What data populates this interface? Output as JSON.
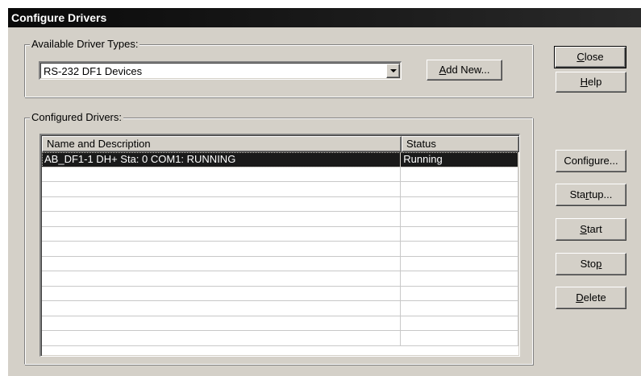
{
  "window": {
    "title": "Configure Drivers"
  },
  "available": {
    "group_label": "Available Driver Types:",
    "selected_value": "RS-232 DF1 Devices",
    "add_new": {
      "mnemonic": "A",
      "rest": "dd New..."
    }
  },
  "configured": {
    "group_label": "Configured Drivers:",
    "columns": [
      "Name and Description",
      "Status"
    ],
    "rows": [
      {
        "name": "AB_DF1-1  DH+ Sta: 0 COM1: RUNNING",
        "status": "Running",
        "selected": true
      }
    ],
    "empty_row_count": 12
  },
  "buttons": {
    "close": {
      "mnemonic": "C",
      "rest": "lose"
    },
    "help": {
      "mnemonic": "H",
      "rest": "elp"
    },
    "configure": {
      "before": "Confi",
      "mnemonic": "g",
      "after": "ure..."
    },
    "startup": {
      "before": "Sta",
      "mnemonic": "r",
      "after": "tup..."
    },
    "start": {
      "mnemonic": "S",
      "rest": "tart"
    },
    "stop": {
      "before": "Sto",
      "mnemonic": "p",
      "after": ""
    },
    "delete": {
      "mnemonic": "D",
      "rest": "elete"
    }
  },
  "colors": {
    "face": "#d4d0c8",
    "selection": "#1a1a1a",
    "titlebar": "#0a0a0a"
  }
}
